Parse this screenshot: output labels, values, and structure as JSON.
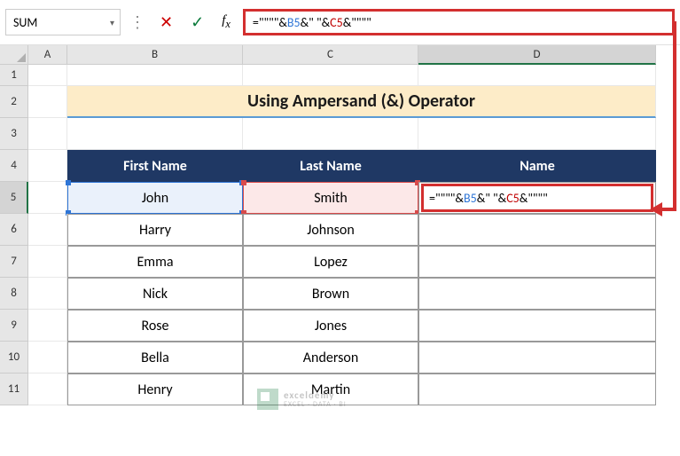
{
  "nameBox": "SUM",
  "formulaBar": {
    "parts": [
      "=\"\"\"\"&",
      "B5",
      "&\" \"&",
      "C5",
      "&\"\"\"\""
    ]
  },
  "columns": [
    "A",
    "B",
    "C",
    "D"
  ],
  "rows": [
    "1",
    "2",
    "3",
    "4",
    "5",
    "6",
    "7",
    "8",
    "9",
    "10",
    "11"
  ],
  "title": "Using Ampersand (&) Operator",
  "headers": {
    "b": "First Name",
    "c": "Last Name",
    "d": "Name"
  },
  "data": [
    {
      "first": "John",
      "last": "Smith"
    },
    {
      "first": "Harry",
      "last": "Johnson"
    },
    {
      "first": "Emma",
      "last": "Lopez"
    },
    {
      "first": "Nick",
      "last": "Brown"
    },
    {
      "first": "Rose",
      "last": "Jones"
    },
    {
      "first": "Bella",
      "last": "Anderson"
    },
    {
      "first": "Henry",
      "last": "Martin"
    }
  ],
  "activeCell": {
    "formulaParts": [
      "=\"\"\"\"&",
      "B5",
      "&\" \"&",
      "C5",
      "&\"\"\"\""
    ]
  },
  "watermark": {
    "brand": "exceldemy",
    "tagline": "EXCEL · DATA · BI"
  }
}
